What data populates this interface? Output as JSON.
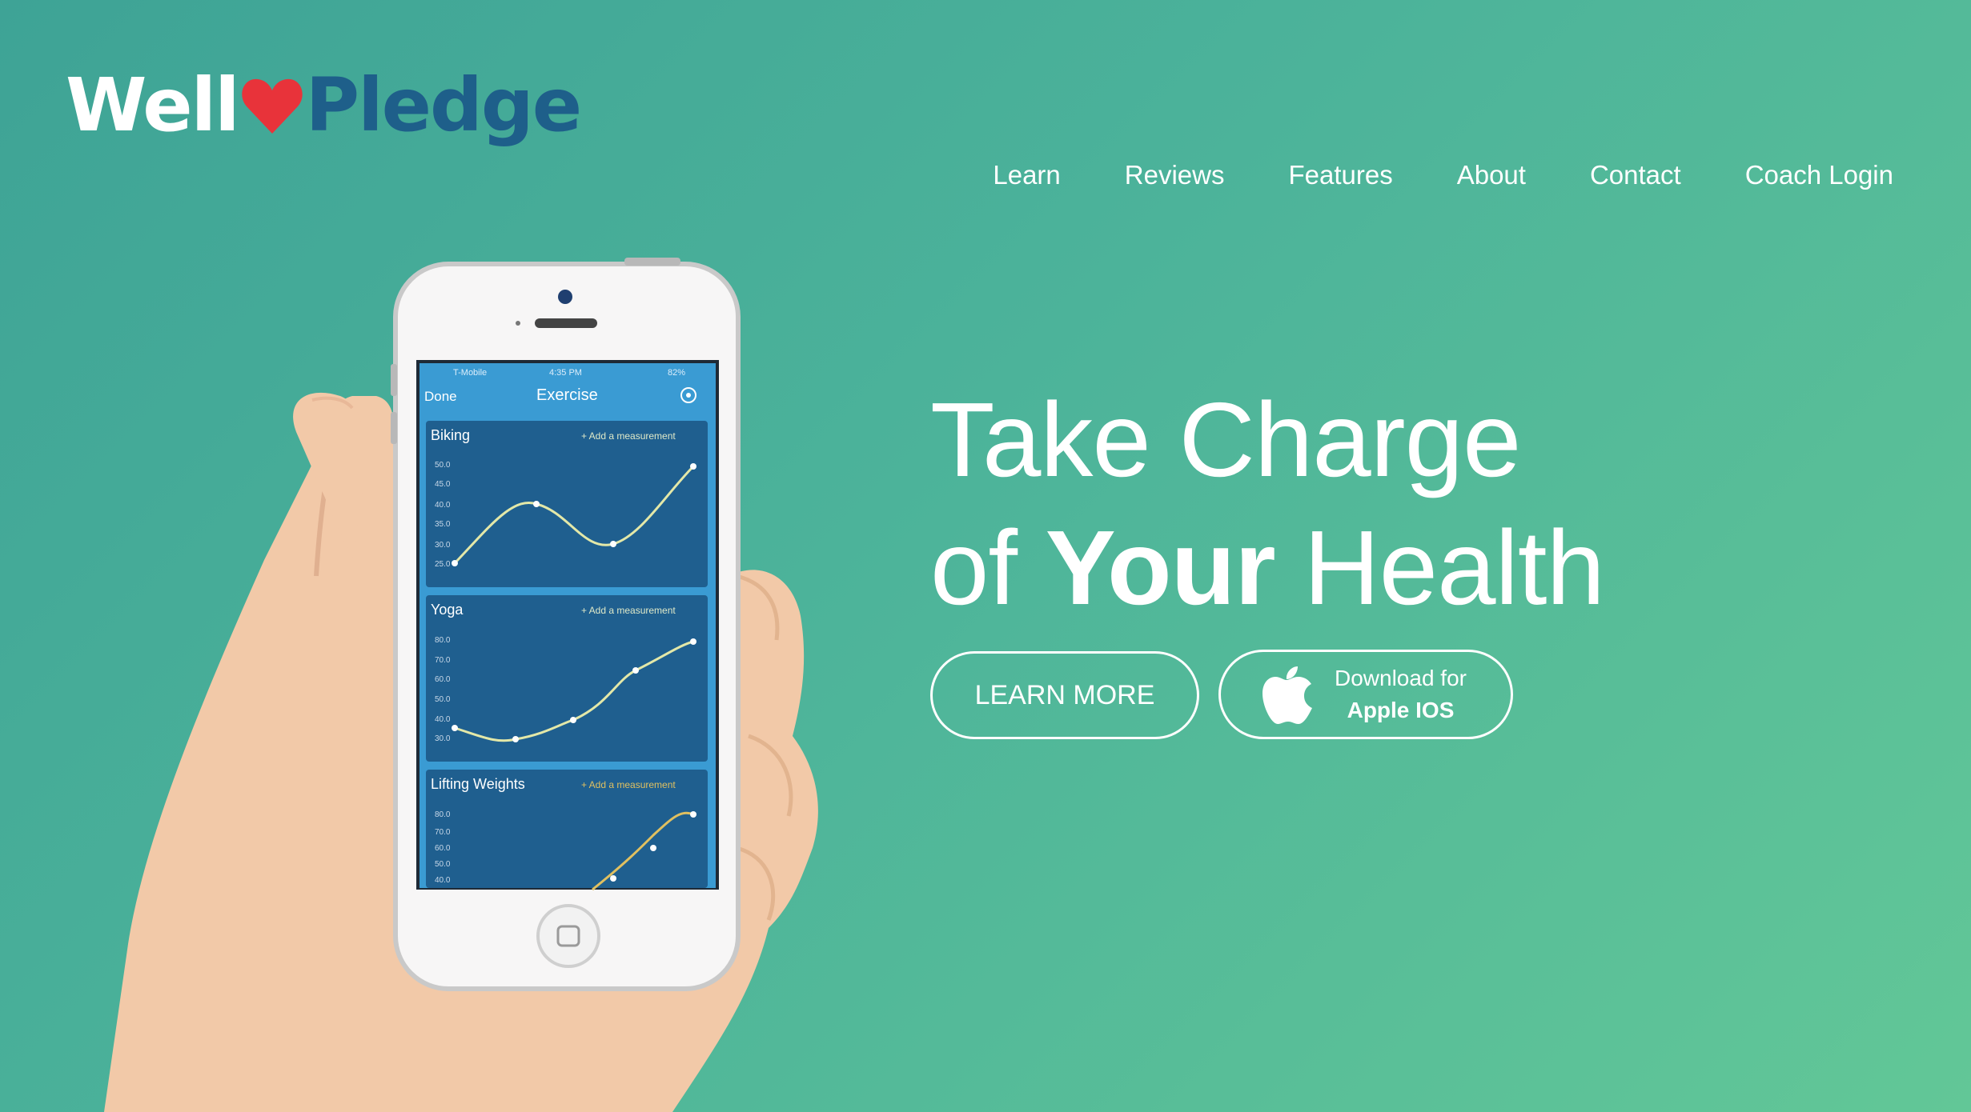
{
  "brand": {
    "part1": "Well",
    "part2": "Pledge"
  },
  "nav": [
    "Learn",
    "Reviews",
    "Features",
    "About",
    "Contact",
    "Coach Login"
  ],
  "hero": {
    "line1": "Take Charge",
    "line2_a": "of ",
    "line2_b": "Your",
    "line2_c": " Health"
  },
  "buttons": {
    "learn_more": "LEARN MORE",
    "download_top": "Download for",
    "download_bottom": "Apple IOS"
  },
  "phone": {
    "status": {
      "carrier": "T-Mobile",
      "time": "4:35 PM",
      "battery": "82%"
    },
    "header": {
      "done": "Done",
      "title": "Exercise"
    },
    "add_label": "+ Add a measurement",
    "charts": [
      {
        "name": "Biking",
        "ticks": [
          "50.0",
          "45.0",
          "40.0",
          "35.0",
          "30.0",
          "25.0"
        ]
      },
      {
        "name": "Yoga",
        "ticks": [
          "80.0",
          "70.0",
          "60.0",
          "50.0",
          "40.0",
          "30.0"
        ]
      },
      {
        "name": "Lifting Weights",
        "ticks": [
          "80.0",
          "70.0",
          "60.0",
          "50.0",
          "40.0"
        ]
      }
    ]
  },
  "colors": {
    "gradient_start": "#3ea396",
    "gradient_end": "#62c797",
    "pledge_blue": "#1e5f8a",
    "heart_red": "#e8333a",
    "screen_blue": "#1f5f8f"
  }
}
